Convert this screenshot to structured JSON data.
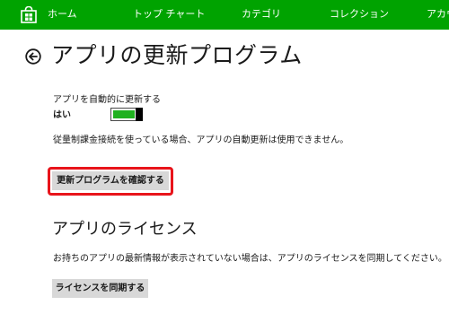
{
  "topnav": {
    "items": [
      {
        "label": "ホーム",
        "icon": "store-bag-icon"
      },
      {
        "label": "トップ チャート"
      },
      {
        "label": "カテゴリ"
      },
      {
        "label": "コレクション"
      },
      {
        "label": "アカウ"
      }
    ]
  },
  "header": {
    "back_icon": "back-arrow-circle-icon",
    "title": "アプリの更新プログラム"
  },
  "auto_update": {
    "label": "アプリを自動的に更新する",
    "state": "はい",
    "on": true,
    "note": "従量制課金接続を使っている場合、アプリの自動更新は使用できません。"
  },
  "check_updates": {
    "button_label": "更新プログラムを確認する",
    "highlighted": true
  },
  "licenses": {
    "title": "アプリのライセンス",
    "description": "お持ちのアプリの最新情報が表示されていない場合は、アプリのライセンスを同期してください。",
    "button_label": "ライセンスを同期する"
  },
  "colors": {
    "nav_background": "#00a300",
    "toggle_fill": "#1fb11f",
    "highlight_border": "#e8141b",
    "button_background": "#d8d8d8"
  }
}
